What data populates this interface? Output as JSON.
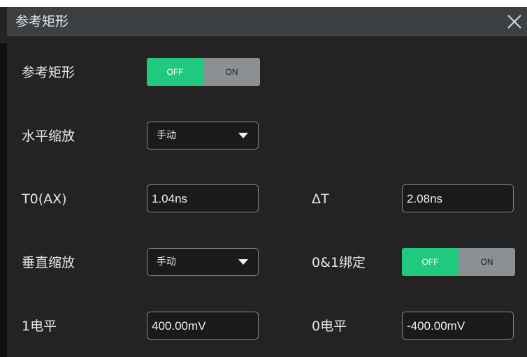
{
  "dialog": {
    "title": "参考矩形",
    "close_icon": "close-icon"
  },
  "rows": {
    "ref_rect": {
      "label": "参考矩形",
      "toggle": {
        "off_label": "OFF",
        "on_label": "ON",
        "state": "OFF"
      }
    },
    "horizontal_scale": {
      "label": "水平缩放",
      "value": "手动"
    },
    "t0": {
      "label": "T0(AX)",
      "value": "1.04ns"
    },
    "delta_t": {
      "label": "ΔT",
      "value": "2.08ns"
    },
    "vertical_scale": {
      "label": "垂直缩放",
      "value": "手动"
    },
    "bind01": {
      "label": "0&1绑定",
      "toggle": {
        "off_label": "OFF",
        "on_label": "ON",
        "state": "OFF"
      }
    },
    "level1": {
      "label": "1电平",
      "value": "400.00mV"
    },
    "level0": {
      "label": "0电平",
      "value": "-400.00mV"
    }
  },
  "colors": {
    "background": "#232323",
    "titlebar": "#3d4043",
    "toggle_active": "#21c97f",
    "toggle_inactive": "#8b9095"
  }
}
